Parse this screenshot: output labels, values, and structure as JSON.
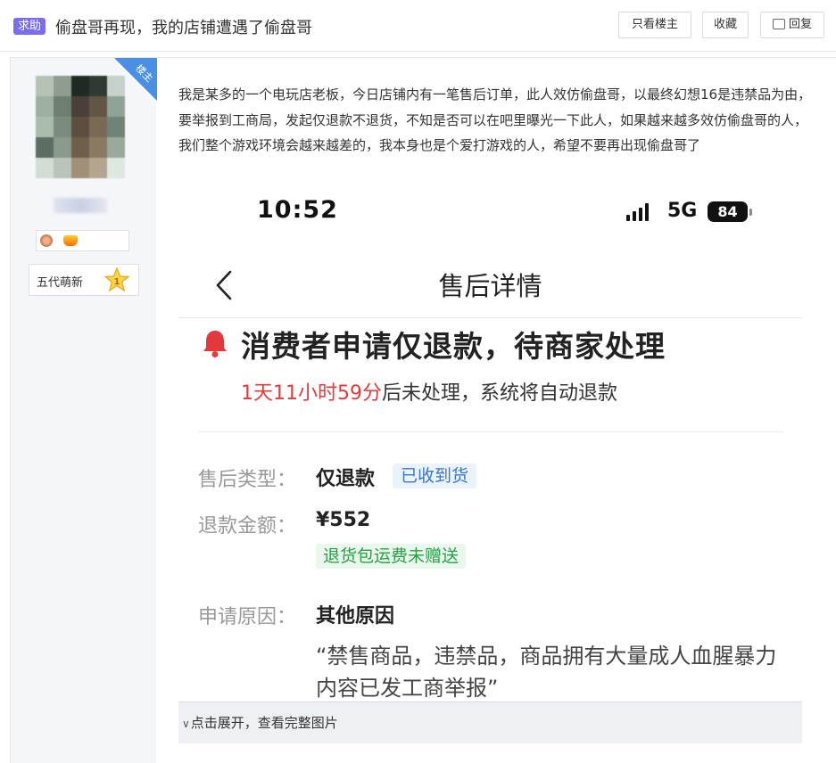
{
  "header": {
    "tag": "求助",
    "title": "偷盘哥再现，我的店铺遭遇了偷盘哥",
    "buttons": {
      "only_op": "只看楼主",
      "favorite": "收藏",
      "reply": "回复"
    }
  },
  "user": {
    "op_ribbon": "楼主",
    "level_title": "五代萌新",
    "level_number": "1",
    "colors": {
      "sidebar_bg": "#f4f6f9",
      "ribbon": "#4a90e2",
      "tag": "#7b6df0"
    }
  },
  "post": {
    "text": "我是某多的一个电玩店老板，今日店铺内有一笔售后订单，此人效仿偷盘哥，以最终幻想16是违禁品为由，要举报到工商局，发起仅退款不退货，不知是否可以在吧里曝光一下此人，如果越来越多效仿偷盘哥的人，我们整个游戏环境会越来越差的，我本身也是个爱打游戏的人，希望不要再出现偷盘哥了"
  },
  "screenshot": {
    "status_bar": {
      "time": "10:52",
      "network": "5G",
      "battery": "84"
    },
    "nav_title": "售后详情",
    "status_title": "消费者申请仅退款，待商家处理",
    "countdown": {
      "time": "1天11小时59分",
      "suffix": "后未处理，系统将自动退款"
    },
    "fields": {
      "type_label": "售后类型：",
      "type_value": "仅退款",
      "type_chip": "已收到货",
      "amount_label": "退款金额：",
      "amount_value": "¥552",
      "amount_chip": "退货包运费未赠送",
      "reason_label": "申请原因：",
      "reason_value": "其他原因",
      "reason_detail": "“禁售商品，违禁品，商品拥有大量成人血腥暴力内容已发工商举报”"
    },
    "colors": {
      "red": "#e4393c",
      "blue_chip": "#3a77c6",
      "green_chip": "#27a045"
    }
  },
  "expand_bar": {
    "label": "点击展开，查看完整图片"
  }
}
